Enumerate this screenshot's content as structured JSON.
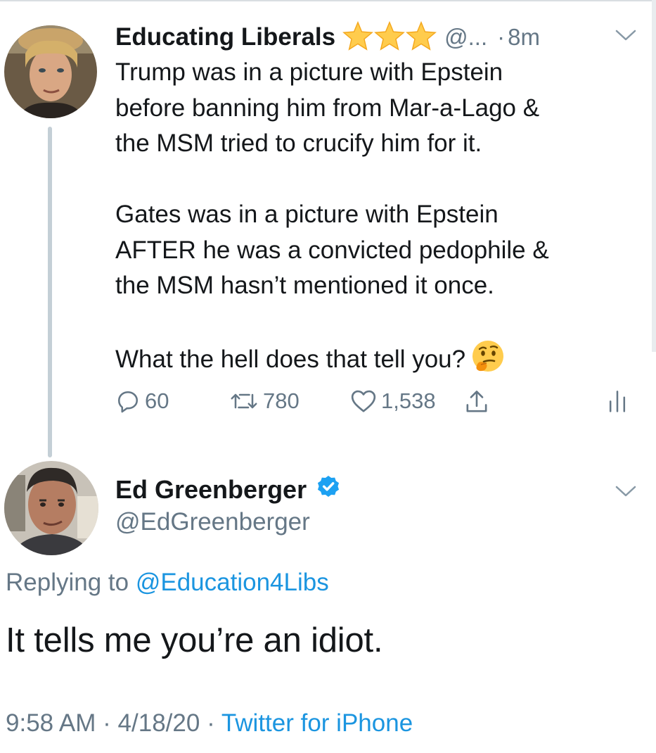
{
  "parent_tweet": {
    "name": "Educating Liberals",
    "badge_icons": [
      "star-icon",
      "star-icon",
      "star-icon"
    ],
    "handle": "@...",
    "separator": "·",
    "time": "8m",
    "lines": [
      "Trump was in a picture with Epstein",
      "before banning him from Mar-a-Lago &",
      "the MSM tried to crucify him for it.",
      "",
      "Gates was in a picture with Epstein",
      "AFTER he was a convicted pedophile &",
      "the MSM hasn’t mentioned it once.",
      "",
      "What the hell does that tell you?"
    ],
    "emoji": "thinking-face-icon",
    "counts": {
      "replies": "60",
      "retweets": "780",
      "likes": "1,538"
    }
  },
  "reply_tweet": {
    "name": "Ed Greenberger",
    "handle": "@EdGreenberger",
    "replying_prefix": "Replying to",
    "replying_to": "@Education4Libs",
    "text": "It tells me you’re an idiot.",
    "time": "9:58 AM",
    "date": "4/18/20",
    "separator": "·",
    "source": "Twitter for iPhone"
  },
  "colors": {
    "text": "#14171a",
    "secondary": "#657786",
    "link": "#1b95e0",
    "verified": "#1da1f2",
    "thread_line": "#c4cfd6",
    "star": "#ffcc4d"
  }
}
